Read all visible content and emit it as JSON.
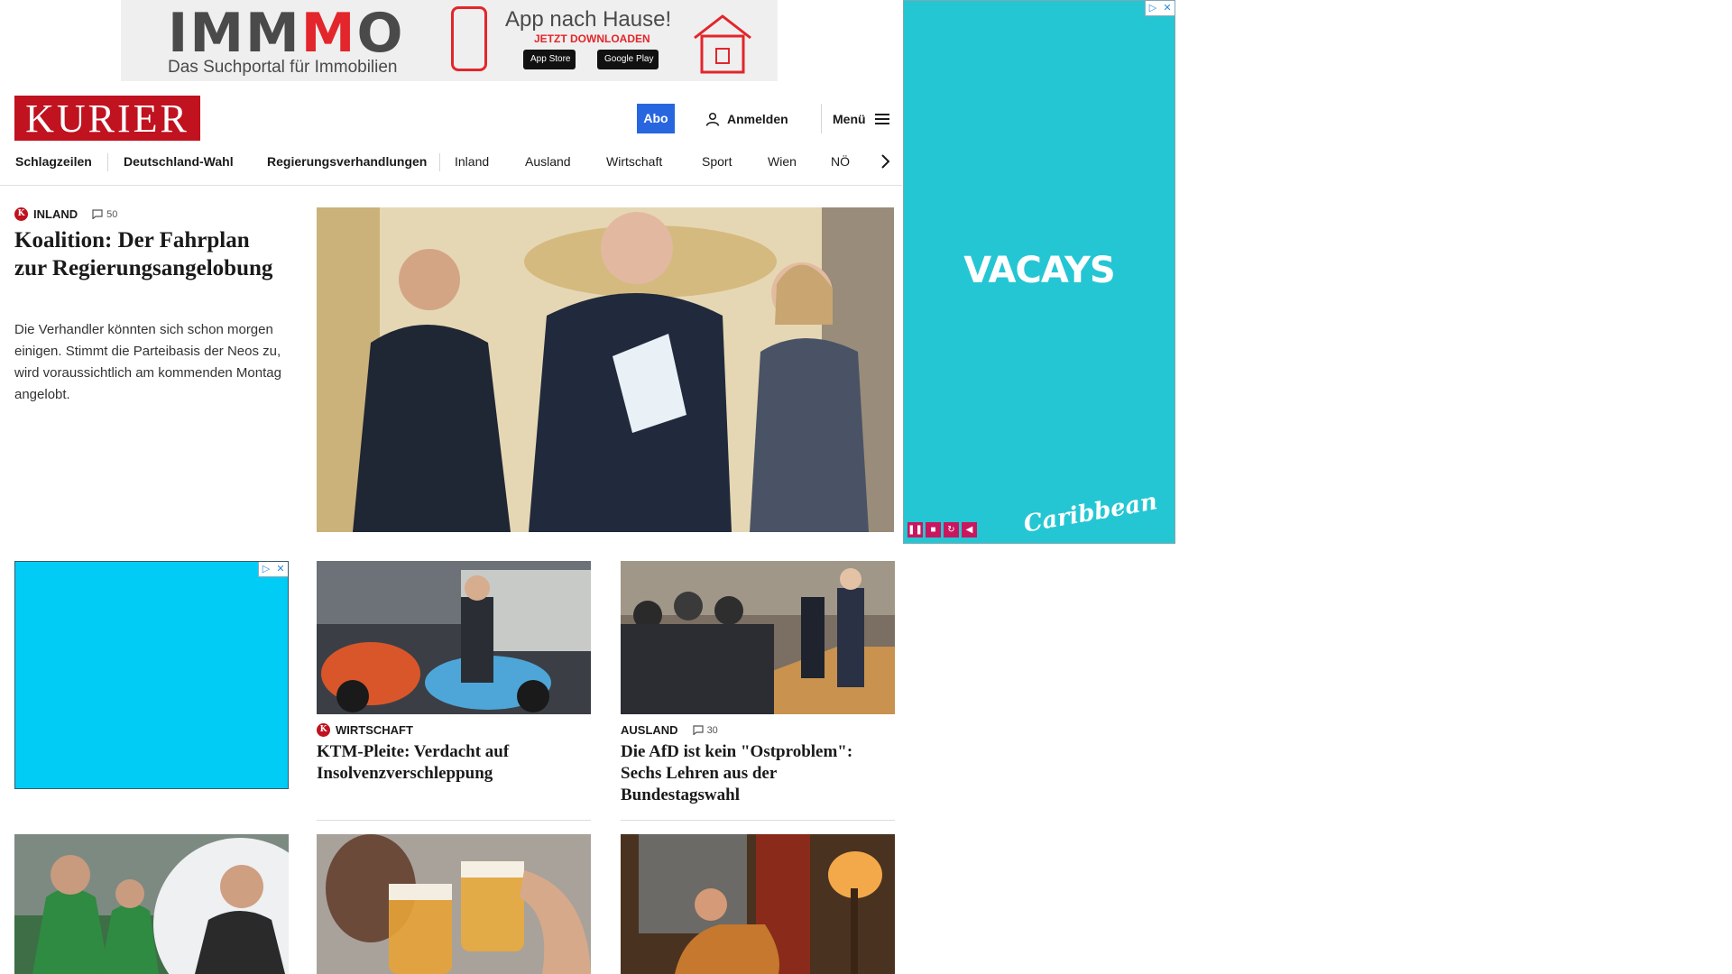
{
  "top_ad": {
    "brand_a": "IMM",
    "brand_b": "M",
    "brand_c": "O",
    "subtitle": "Das Suchportal für Immobilien",
    "headline": "App nach Hause!",
    "cta": "JETZT DOWNLOADEN",
    "app_store": "App Store",
    "google_play": "Google Play"
  },
  "side_ad": {
    "headline": "VACAYS",
    "brand": "Caribbean",
    "accent": "#25c6d3"
  },
  "header": {
    "logo": "KURIER",
    "abo_label": "Abo",
    "login_label": "Anmelden",
    "menu_label": "Menü"
  },
  "nav": {
    "items": [
      "Schlagzeilen",
      "Deutschland-Wahl",
      "Regierungsverhandlungen",
      "Inland",
      "Ausland",
      "Wirtschaft",
      "Sport",
      "Wien",
      "NÖ"
    ]
  },
  "lead": {
    "badge": "K",
    "category": "INLAND",
    "comments": "50",
    "title": "Koalition: Der Fahrplan zur Regierungsangelobung",
    "teaser": "Die Verhandler könnten sich schon morgen einigen. Stimmt die Parteibasis der Neos zu, wird voraussichtlich am kommenden Montag angelobt."
  },
  "cards": [
    {
      "badge": "K",
      "category": "WIRTSCHAFT",
      "comments": "",
      "title": "KTM-Pleite: Verdacht auf Insolvenzverschleppung"
    },
    {
      "badge": "",
      "category": "AUSLAND",
      "comments": "30",
      "title": "Die AfD ist kein \"Ostproblem\": Sechs Lehren aus der Bundestagswahl"
    }
  ],
  "colors": {
    "brand_red": "#c0121f",
    "abo_blue": "#2866e0",
    "grid_ad_blue": "#00ccf5"
  }
}
